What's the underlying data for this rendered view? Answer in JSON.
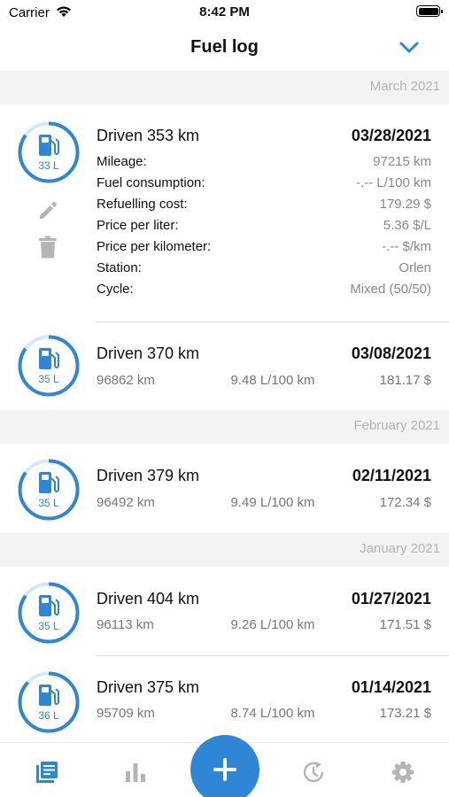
{
  "status_bar": {
    "carrier": "Carrier",
    "time": "8:42 PM"
  },
  "header": {
    "title": "Fuel log",
    "collapse_icon": "chevron-down-icon"
  },
  "colors": {
    "accent": "#2f86d6",
    "gauge_track": "#d6e7f7",
    "section_bg": "#f3f3f3",
    "muted_text": "#888888"
  },
  "sections": [
    {
      "label": "March 2021",
      "entries": [
        {
          "title": "Driven 353 km",
          "date": "03/28/2021",
          "liters": "33 L",
          "fill_fraction": 0.85,
          "expanded": true,
          "details": [
            {
              "label": "Mileage:",
              "value": "97215 km"
            },
            {
              "label": "Fuel consumption:",
              "value": "-.-- L/100 km"
            },
            {
              "label": "Refuelling cost:",
              "value": "179.29 $"
            },
            {
              "label": "Price per liter:",
              "value": "5.36 $/L"
            },
            {
              "label": "Price per kilometer:",
              "value": "-.-- $/km"
            },
            {
              "label": "Station:",
              "value": "Orlen"
            },
            {
              "label": "Cycle:",
              "value": "Mixed (50/50)"
            }
          ]
        },
        {
          "title": "Driven 370 km",
          "date": "03/08/2021",
          "liters": "35 L",
          "fill_fraction": 0.85,
          "mileage": "96862 km",
          "consumption": "9.48 L/100 km",
          "cost": "181.17 $"
        }
      ]
    },
    {
      "label": "February 2021",
      "entries": [
        {
          "title": "Driven 379 km",
          "date": "02/11/2021",
          "liters": "35 L",
          "fill_fraction": 0.85,
          "mileage": "96492 km",
          "consumption": "9.49 L/100 km",
          "cost": "172.34 $"
        }
      ]
    },
    {
      "label": "January 2021",
      "entries": [
        {
          "title": "Driven 404 km",
          "date": "01/27/2021",
          "liters": "35 L",
          "fill_fraction": 0.85,
          "mileage": "96113 km",
          "consumption": "9.26 L/100 km",
          "cost": "171.51 $"
        },
        {
          "title": "Driven 375 km",
          "date": "01/14/2021",
          "liters": "36 L",
          "fill_fraction": 0.87,
          "mileage": "95709 km",
          "consumption": "8.74 L/100 km",
          "cost": "173.21 $"
        }
      ]
    }
  ],
  "tabbar": {
    "items": [
      "log-icon",
      "statistics-icon",
      "add-icon",
      "reminders-icon",
      "settings-icon"
    ],
    "active": "log-icon"
  }
}
